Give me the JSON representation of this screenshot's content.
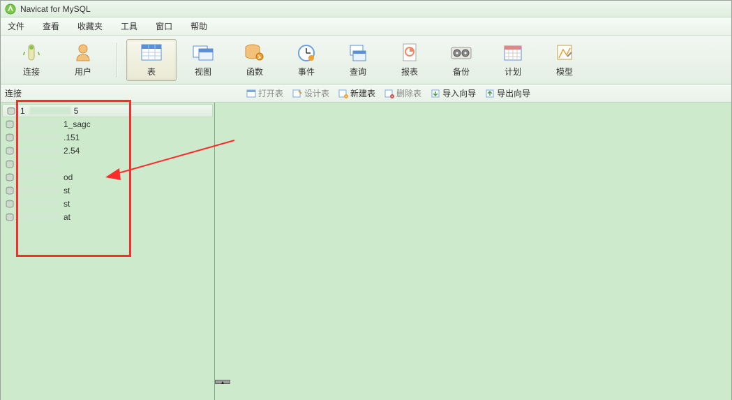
{
  "title": "Navicat for MySQL",
  "menu": [
    "文件",
    "查看",
    "收藏夹",
    "工具",
    "窗口",
    "帮助"
  ],
  "toolbar": [
    {
      "label": "连接",
      "icon": "connect-icon"
    },
    {
      "label": "用户",
      "icon": "user-icon"
    },
    {
      "label": "表",
      "icon": "table-icon",
      "active": true
    },
    {
      "label": "视图",
      "icon": "view-icon"
    },
    {
      "label": "函数",
      "icon": "function-icon"
    },
    {
      "label": "事件",
      "icon": "event-icon"
    },
    {
      "label": "查询",
      "icon": "query-icon"
    },
    {
      "label": "报表",
      "icon": "report-icon"
    },
    {
      "label": "备份",
      "icon": "backup-icon"
    },
    {
      "label": "计划",
      "icon": "schedule-icon"
    },
    {
      "label": "模型",
      "icon": "model-icon"
    }
  ],
  "sidebar_header": "连接",
  "subtoolbar": [
    {
      "label": "打开表",
      "disabled": true
    },
    {
      "label": "设计表",
      "disabled": true
    },
    {
      "label": "新建表",
      "disabled": false
    },
    {
      "label": "删除表",
      "disabled": true
    },
    {
      "label": "导入向导",
      "disabled": false
    },
    {
      "label": "导出向导",
      "disabled": false
    }
  ],
  "connections": [
    {
      "prefix": "1",
      "suffix": "5",
      "selected": true
    },
    {
      "prefix": "",
      "suffix": "1_sagc"
    },
    {
      "prefix": "",
      "suffix": ".151"
    },
    {
      "prefix": "",
      "suffix": "2.54"
    },
    {
      "prefix": "",
      "suffix": ""
    },
    {
      "prefix": "",
      "suffix": "od"
    },
    {
      "prefix": "",
      "suffix": "st"
    },
    {
      "prefix": "",
      "suffix": "st"
    },
    {
      "prefix": "",
      "suffix": "at"
    }
  ]
}
